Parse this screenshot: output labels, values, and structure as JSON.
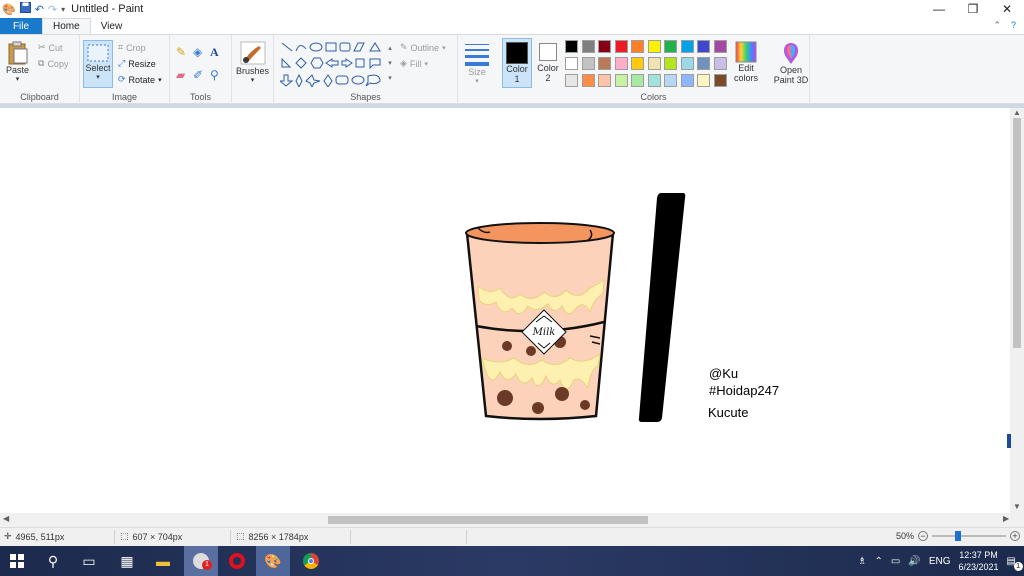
{
  "app": {
    "title": "Untitled - Paint",
    "tabs": [
      "Home",
      "View"
    ],
    "file_label": "File"
  },
  "ribbon": {
    "clipboard": {
      "paste": "Paste",
      "cut": "Cut",
      "copy": "Copy",
      "label": "Clipboard"
    },
    "image": {
      "select": "Select",
      "crop": "Crop",
      "resize": "Resize",
      "rotate": "Rotate",
      "label": "Image"
    },
    "tools": {
      "label": "Tools"
    },
    "brushes": {
      "label": "Brushes"
    },
    "shapes": {
      "outline": "Outline",
      "fill": "Fill",
      "label": "Shapes"
    },
    "size": {
      "label": "Size"
    },
    "colors": {
      "color1": "Color 1",
      "color1_num": "1",
      "color1_word": "Color",
      "color2_word": "Color",
      "color2_num": "2",
      "edit": "Edit colors",
      "edit_line1": "Edit",
      "edit_line2": "colors",
      "label": "Colors",
      "swatches_row1": [
        "#000000",
        "#7f7f7f",
        "#880015",
        "#ed1c24",
        "#ff7f27",
        "#fff200",
        "#22b14c",
        "#00a2e8",
        "#3f48cc",
        "#a349a4"
      ],
      "swatches_row2": [
        "#ffffff",
        "#c3c3c3",
        "#b97a57",
        "#ffaec9",
        "#ffc90e",
        "#efe4b0",
        "#b5e61d",
        "#99d9ea",
        "#7092be",
        "#c8bfe7"
      ],
      "swatches_row3": [
        "#e6e6e6",
        "#ff8c49",
        "#fdc4a8",
        "#c7f2a4",
        "#a6eba1",
        "#a3e2dc",
        "#b7d7f5",
        "#8fb7ff",
        "#fff5c0",
        "#7a4b2a"
      ]
    },
    "paint3d": {
      "line1": "Open",
      "line2": "Paint 3D"
    }
  },
  "artwork": {
    "milk_label": "Milk",
    "text_line1": "@Ku",
    "text_line2": "#Hoidap247",
    "text_line3": "Kucute",
    "colors": {
      "cup_top": "#f49560",
      "tea": "#fdd2bb",
      "cream": "#fdf0b0",
      "pearl": "#6b3a26",
      "straw": "#000000"
    }
  },
  "status": {
    "cursor": "4965, 511px",
    "selection": "607 × 704px",
    "image_size": "8256 × 1784px",
    "zoom": "50%"
  },
  "taskbar": {
    "lang": "ENG",
    "time": "12:37 PM",
    "date": "6/23/2021",
    "notif_count": "1",
    "badge": "1"
  }
}
